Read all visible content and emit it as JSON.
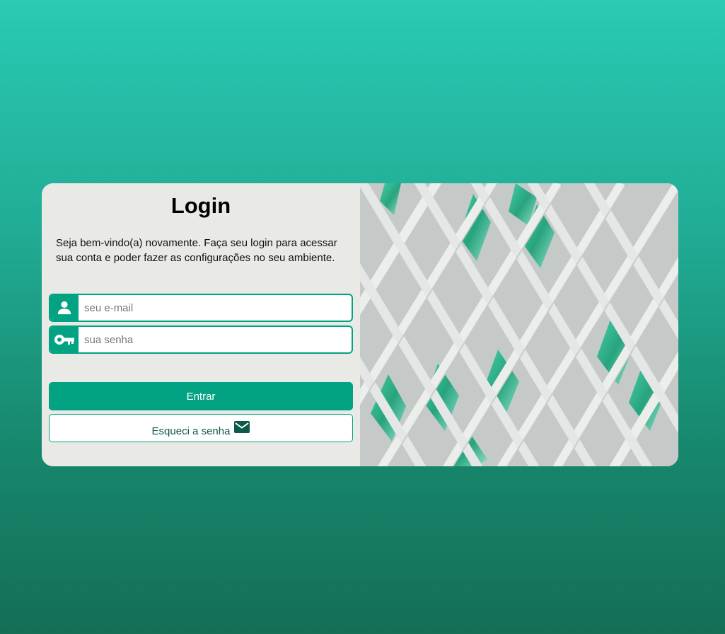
{
  "login": {
    "title": "Login",
    "intro": "Seja bem-vindo(a) novamente. Faça seu login para acessar sua conta e poder fazer as configurações no seu ambiente.",
    "email": {
      "placeholder": "seu e-mail",
      "value": "",
      "icon": "user-icon"
    },
    "password": {
      "placeholder": "sua senha",
      "value": "",
      "icon": "key-icon"
    },
    "submit_label": "Entrar",
    "forgot_label": "Esqueci a senha",
    "forgot_icon": "envelope-icon"
  },
  "colors": {
    "accent": "#02a383",
    "card_background": "#e9eae6",
    "page_gradient_top": "#2acab3",
    "page_gradient_bottom": "#146e56",
    "forgot_text": "#0d5a4a"
  },
  "decorative_image": {
    "description_icon": "building-lattice-image"
  }
}
